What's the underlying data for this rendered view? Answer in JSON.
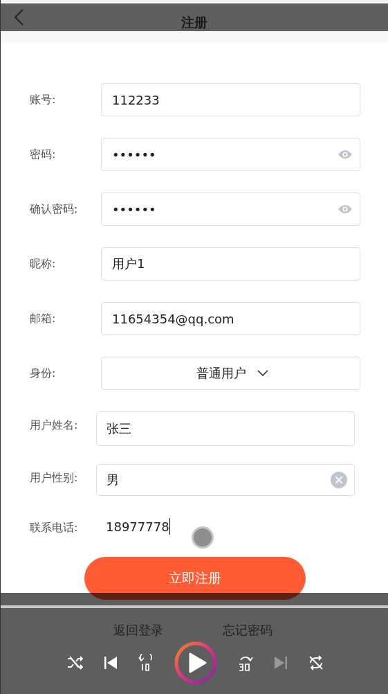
{
  "header": {
    "title": "注册"
  },
  "account_fields": [
    {
      "kind": "text",
      "label": "账号:",
      "value": "112233"
    },
    {
      "kind": "password",
      "label": "密码:",
      "value": "••••••"
    },
    {
      "kind": "password",
      "label": "确认密码:",
      "value": "••••••"
    },
    {
      "kind": "text",
      "label": "昵称:",
      "value": "用户1"
    },
    {
      "kind": "text",
      "label": "邮箱:",
      "value": "11654354@qq.com"
    },
    {
      "kind": "select",
      "label": "身份:",
      "value": "普通用户"
    }
  ],
  "profile_fields": [
    {
      "kind": "text",
      "label": "用户姓名:",
      "value": "张三",
      "focused": false
    },
    {
      "kind": "clear",
      "label": "用户性别:",
      "value": "男",
      "focused": false
    },
    {
      "kind": "bare",
      "label": "联系电话:",
      "value": "18977778",
      "focused": true
    }
  ],
  "submit": "立即注册",
  "links": [
    "返回登录",
    "忘记密码"
  ],
  "player": {
    "level": 1
  }
}
